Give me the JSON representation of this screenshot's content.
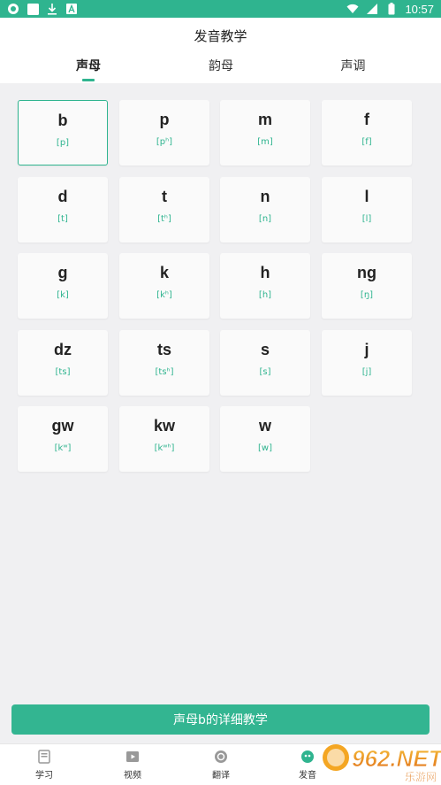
{
  "status_bar": {
    "time": "10:57",
    "left_icons": [
      "app-notification-icon",
      "white-square-icon",
      "download-icon",
      "text-a-icon"
    ],
    "right_icons": [
      "wifi-icon",
      "signal-icon",
      "battery-icon"
    ]
  },
  "header": {
    "title": "发音教学",
    "tabs": [
      {
        "label": "声母",
        "active": true
      },
      {
        "label": "韵母",
        "active": false
      },
      {
        "label": "声调",
        "active": false
      }
    ]
  },
  "initials": [
    {
      "letter": "b",
      "ipa": "[p]"
    },
    {
      "letter": "p",
      "ipa": "[pʰ]"
    },
    {
      "letter": "m",
      "ipa": "[m]"
    },
    {
      "letter": "f",
      "ipa": "[f]"
    },
    {
      "letter": "d",
      "ipa": "[t]"
    },
    {
      "letter": "t",
      "ipa": "[tʰ]"
    },
    {
      "letter": "n",
      "ipa": "[n]"
    },
    {
      "letter": "l",
      "ipa": "[l]"
    },
    {
      "letter": "g",
      "ipa": "[k]"
    },
    {
      "letter": "k",
      "ipa": "[kʰ]"
    },
    {
      "letter": "h",
      "ipa": "[h]"
    },
    {
      "letter": "ng",
      "ipa": "[ŋ]"
    },
    {
      "letter": "dz",
      "ipa": "[ts]"
    },
    {
      "letter": "ts",
      "ipa": "[tsʰ]"
    },
    {
      "letter": "s",
      "ipa": "[s]"
    },
    {
      "letter": "j",
      "ipa": "[j]"
    },
    {
      "letter": "gw",
      "ipa": "[kʷ]"
    },
    {
      "letter": "kw",
      "ipa": "[kʷʰ]"
    },
    {
      "letter": "w",
      "ipa": "[w]"
    }
  ],
  "selected_initial": "b",
  "detail_button": "声母b的详细教学",
  "bottom_nav": [
    {
      "label": "学习",
      "icon": "book-icon"
    },
    {
      "label": "视频",
      "icon": "video-icon"
    },
    {
      "label": "翻译",
      "icon": "translate-icon"
    },
    {
      "label": "发音",
      "icon": "pronunciation-icon"
    }
  ],
  "watermark": {
    "text": "962.NET",
    "subtext": "乐游网"
  },
  "colors": {
    "accent": "#2fb48f",
    "button": "#33b591",
    "background": "#f0f0f2",
    "card": "#fafafa"
  }
}
